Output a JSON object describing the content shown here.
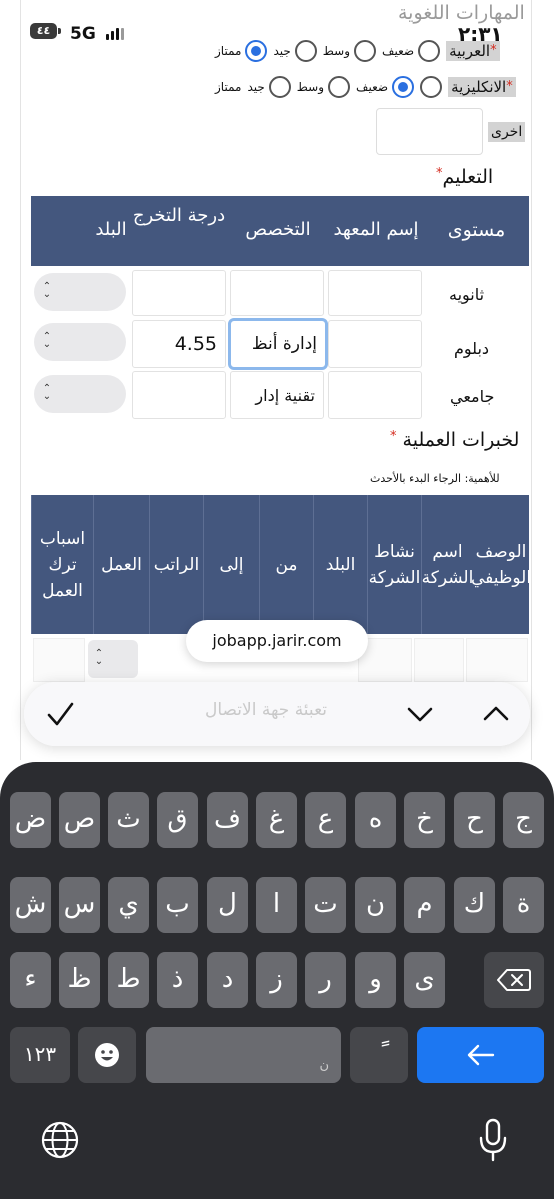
{
  "status_bar": {
    "battery": "٤٤",
    "network": "5G",
    "time": "٢:٣١"
  },
  "language_skills": {
    "title": "المهارات اللغوية",
    "rows": [
      {
        "label": "العربية",
        "required": "*",
        "options": [
          "ضعيف",
          "وسط",
          "جيد",
          "ممتاز"
        ],
        "selected": "ممتاز"
      },
      {
        "label": "الانكليزية",
        "required": "*",
        "options": [
          "ضعيف",
          "وسط",
          "جيد",
          "ممتاز"
        ],
        "selected": "ضعيف"
      }
    ],
    "other_label": "اخرى",
    "other_value": ""
  },
  "education": {
    "title": "التعليم",
    "required": "*",
    "headers": [
      "مستوى",
      "إسم المعهد",
      "التخصص",
      "درجة التخرج",
      "البلد"
    ],
    "rows": [
      {
        "level": "ثانويه",
        "institute": "",
        "major": "",
        "grade": "",
        "country": ""
      },
      {
        "level": "دبلوم",
        "institute": "",
        "major": "إدارة أنظ",
        "grade": "4.55",
        "country": ""
      },
      {
        "level": "جامعي",
        "institute": "",
        "major": "تقنية إدار",
        "grade": "",
        "country": ""
      }
    ]
  },
  "experience": {
    "title": "لخبرات العملية",
    "required": "*",
    "note": "للأهمية: الرجاء البدء بالأحدث",
    "headers": [
      "الوصف الوظيفي",
      "اسم الشركة",
      "نشاط الشركة",
      "البلد",
      "من",
      "إلى",
      "الراتب",
      "العمل",
      "اسباب ترك العمل"
    ],
    "ghost_text": "تعبئة جهة الاتصال"
  },
  "browser": {
    "url": "jobapp.jarir.com"
  },
  "keyboard": {
    "row1": [
      "ض",
      "ص",
      "ث",
      "ق",
      "ف",
      "غ",
      "ع",
      "ه",
      "خ",
      "ح",
      "ج"
    ],
    "row2": [
      "ش",
      "س",
      "ي",
      "ب",
      "ل",
      "ا",
      "ت",
      "ن",
      "م",
      "ك",
      "ة"
    ],
    "row3": [
      "ء",
      "ظ",
      "ط",
      "ذ",
      "د",
      "ز",
      "ر",
      "و",
      "ى"
    ],
    "numbers_label": "١٢٣",
    "space_label": "ن",
    "tanween_label": "ً"
  },
  "colors": {
    "table_header": "#44577e",
    "accent": "#2a6fe0",
    "return_key": "#1c77f2"
  }
}
